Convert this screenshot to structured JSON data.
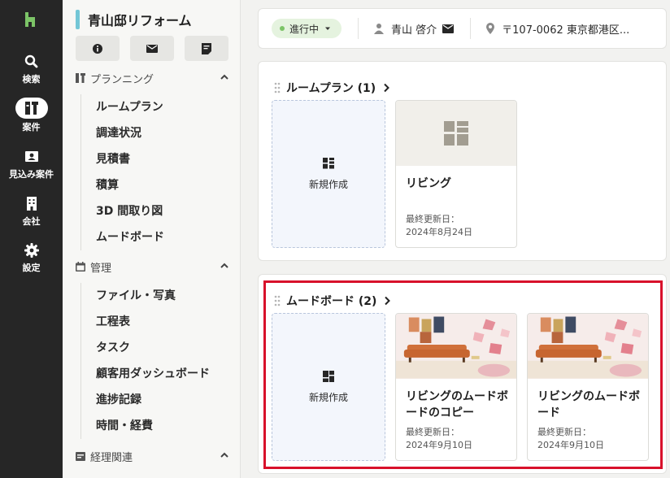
{
  "rail": {
    "items": [
      {
        "label": "検索",
        "icon": "search-icon"
      },
      {
        "label": "案件",
        "icon": "project-icon"
      },
      {
        "label": "見込み案件",
        "icon": "prospect-icon"
      },
      {
        "label": "会社",
        "icon": "building-icon"
      },
      {
        "label": "設定",
        "icon": "gear-icon"
      }
    ]
  },
  "project": {
    "title": "青山邸リフォーム",
    "accent": "#73c6d6"
  },
  "sections": [
    {
      "label": "プランニング",
      "items": [
        "ルームプラン",
        "調達状況",
        "見積書",
        "積算",
        "3D 間取り図",
        "ムードボード"
      ]
    },
    {
      "label": "管理",
      "items": [
        "ファイル・写真",
        "工程表",
        "タスク",
        "顧客用ダッシュボード",
        "進捗記録",
        "時間・経費"
      ]
    },
    {
      "label": "経理関連",
      "items": []
    }
  ],
  "topbar": {
    "status": "進行中",
    "person": "青山 啓介",
    "address": "〒107-0062 東京都港区..."
  },
  "roomplan": {
    "title": "ルームプラン (1)",
    "new_label": "新規作成",
    "cards": [
      {
        "name": "リビング",
        "updated_label": "最終更新日：",
        "updated": "2024年8月24日"
      }
    ]
  },
  "moodboard": {
    "title": "ムードボード (2)",
    "new_label": "新規作成",
    "cards": [
      {
        "name": "リビングのムードボードのコピー",
        "updated_label": "最終更新日：",
        "updated": "2024年9月10日"
      },
      {
        "name": "リビングのムードボード",
        "updated_label": "最終更新日：",
        "updated": "2024年9月10日"
      }
    ]
  },
  "colors": {
    "rail_bg": "#262626",
    "logo_green": "#7cc467",
    "highlight": "#d8112b"
  }
}
